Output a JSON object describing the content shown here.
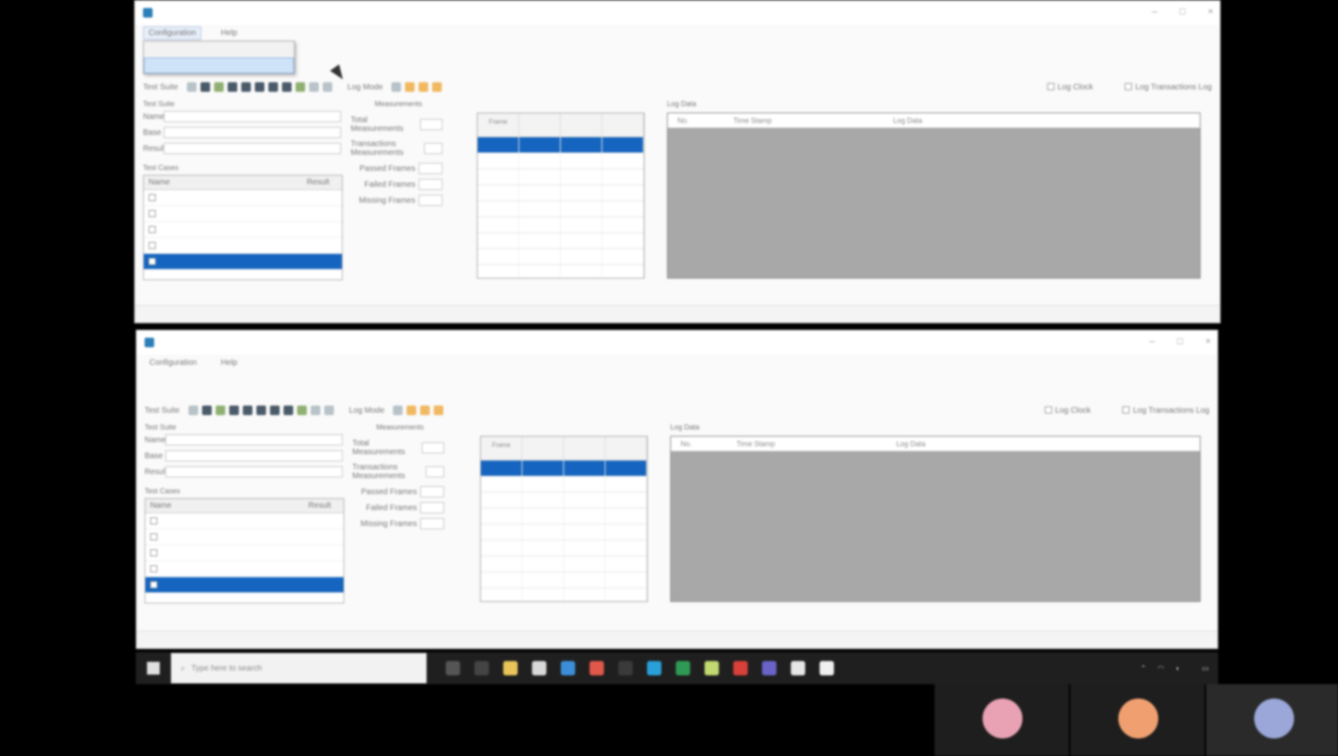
{
  "colors": {
    "selection_blue": "#1565c0",
    "log_panel_gray": "#a8a8a8",
    "app_icon": "#2a7fb8",
    "avatar_1": "#e8a2b3",
    "avatar_2": "#f0a070",
    "avatar_3": "#9aa7d8"
  },
  "top_window": {
    "title": "",
    "menu": {
      "configuration": "Configuration",
      "help": "Help"
    },
    "dropdown": {
      "item1": "",
      "item2": ""
    }
  },
  "bottom_window": {
    "title": "",
    "menu": {
      "configuration": "Configuration",
      "help": "Help"
    }
  },
  "toolbar": {
    "test_suite": "Test Suite",
    "log_mode": "Log Mode",
    "log_clock": "Log Clock",
    "log_transactions": "Log Transactions Log"
  },
  "test_suite": {
    "title": "Test Suite",
    "name_label": "Name",
    "name_value": "",
    "base_label": "Base",
    "base_value": "",
    "result_label": "Result",
    "result_value": ""
  },
  "test_cases": {
    "title": "Test Cases",
    "col_name": "Name",
    "col_result": "Result"
  },
  "measurements": {
    "title": "Measurements",
    "total": "Total Measurements",
    "transactions": "Transactions Measurements",
    "passed": "Passed Frames",
    "failed": "Failed Frames",
    "missing": "Missing Frames"
  },
  "grid": {
    "col_frame": "Frame",
    "col2": "",
    "col3": "",
    "col4": ""
  },
  "log": {
    "title": "Log Data",
    "col1": "No.",
    "col2": "Time Stamp",
    "col3": "Log Data"
  },
  "taskbar": {
    "search_placeholder": "Type here to search",
    "time": "",
    "date": ""
  },
  "participants": [
    {
      "initials": "",
      "name": ""
    },
    {
      "initials": "",
      "name": ""
    },
    {
      "initials": "",
      "name": ""
    }
  ]
}
